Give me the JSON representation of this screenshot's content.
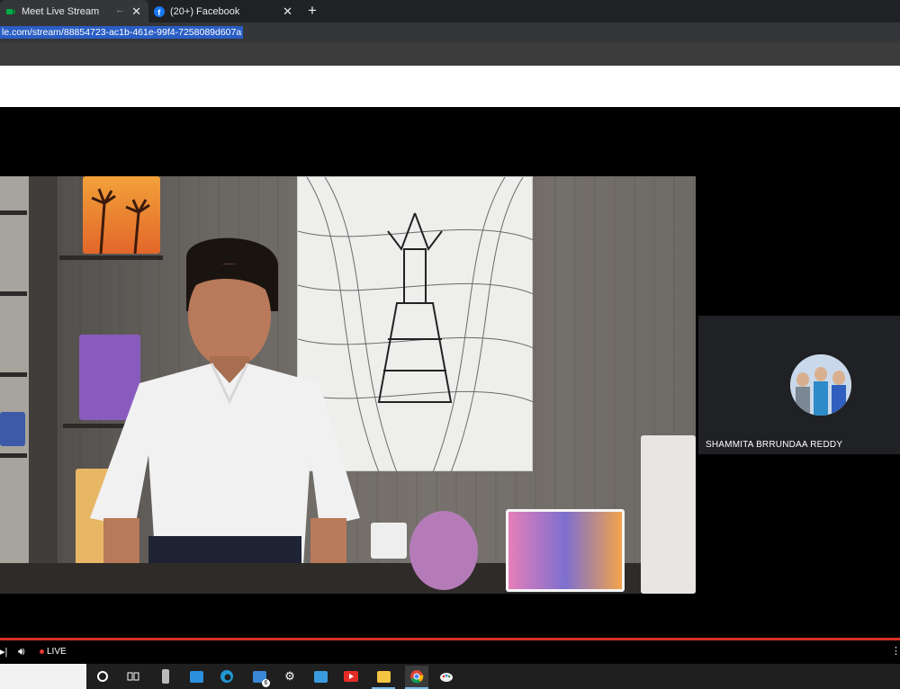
{
  "tabs": [
    {
      "label": "Meet Live Stream",
      "active": true,
      "icon": "meet-icon"
    },
    {
      "label": "(20+) Facebook",
      "active": false,
      "icon": "facebook-icon"
    }
  ],
  "new_tab_symbol": "+",
  "address": {
    "url": "le.com/stream/88854723-ac1b-461e-99f4-7258089d607a"
  },
  "participant": {
    "name": "SHAMMITA BRRUNDAA REDDY"
  },
  "player": {
    "live_label": "LIVE"
  },
  "taskbar": {
    "icons": [
      "cortana-icon",
      "task-view-icon",
      "usb-icon",
      "store-icon",
      "edge-icon",
      "mail-icon",
      "settings-icon",
      "app-icon",
      "youtube-icon",
      "file-explorer-icon",
      "chrome-icon",
      "paint-icon"
    ],
    "mail_badge": "6"
  },
  "colors": {
    "accent": "#d93025",
    "url_highlight": "#2a5ec4"
  }
}
